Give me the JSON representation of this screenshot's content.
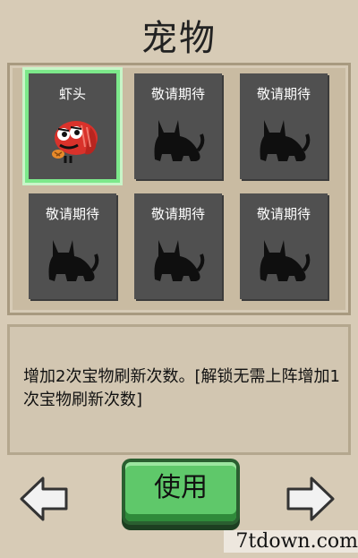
{
  "screen_title": "宠物",
  "pets": [
    {
      "name": "虾头",
      "state": "owned",
      "selected": true,
      "icon": "shrimp-head-icon"
    },
    {
      "name": "敬请期待",
      "state": "locked",
      "icon": "cat-silhouette-icon"
    },
    {
      "name": "敬请期待",
      "state": "locked",
      "icon": "cat-silhouette-icon"
    },
    {
      "name": "敬请期待",
      "state": "locked",
      "icon": "cat-silhouette-icon"
    },
    {
      "name": "敬请期待",
      "state": "locked",
      "icon": "cat-silhouette-icon"
    },
    {
      "name": "敬请期待",
      "state": "locked",
      "icon": "cat-silhouette-icon"
    }
  ],
  "description": "增加2次宝物刷新次数。[解锁无需上阵增加1次宝物刷新次数]",
  "use_button_label": "使用",
  "watermark": "7tdown.com",
  "colors": {
    "selected_border": "#7ce88a",
    "button": "#5fc86a",
    "slot_bg": "#505050"
  }
}
